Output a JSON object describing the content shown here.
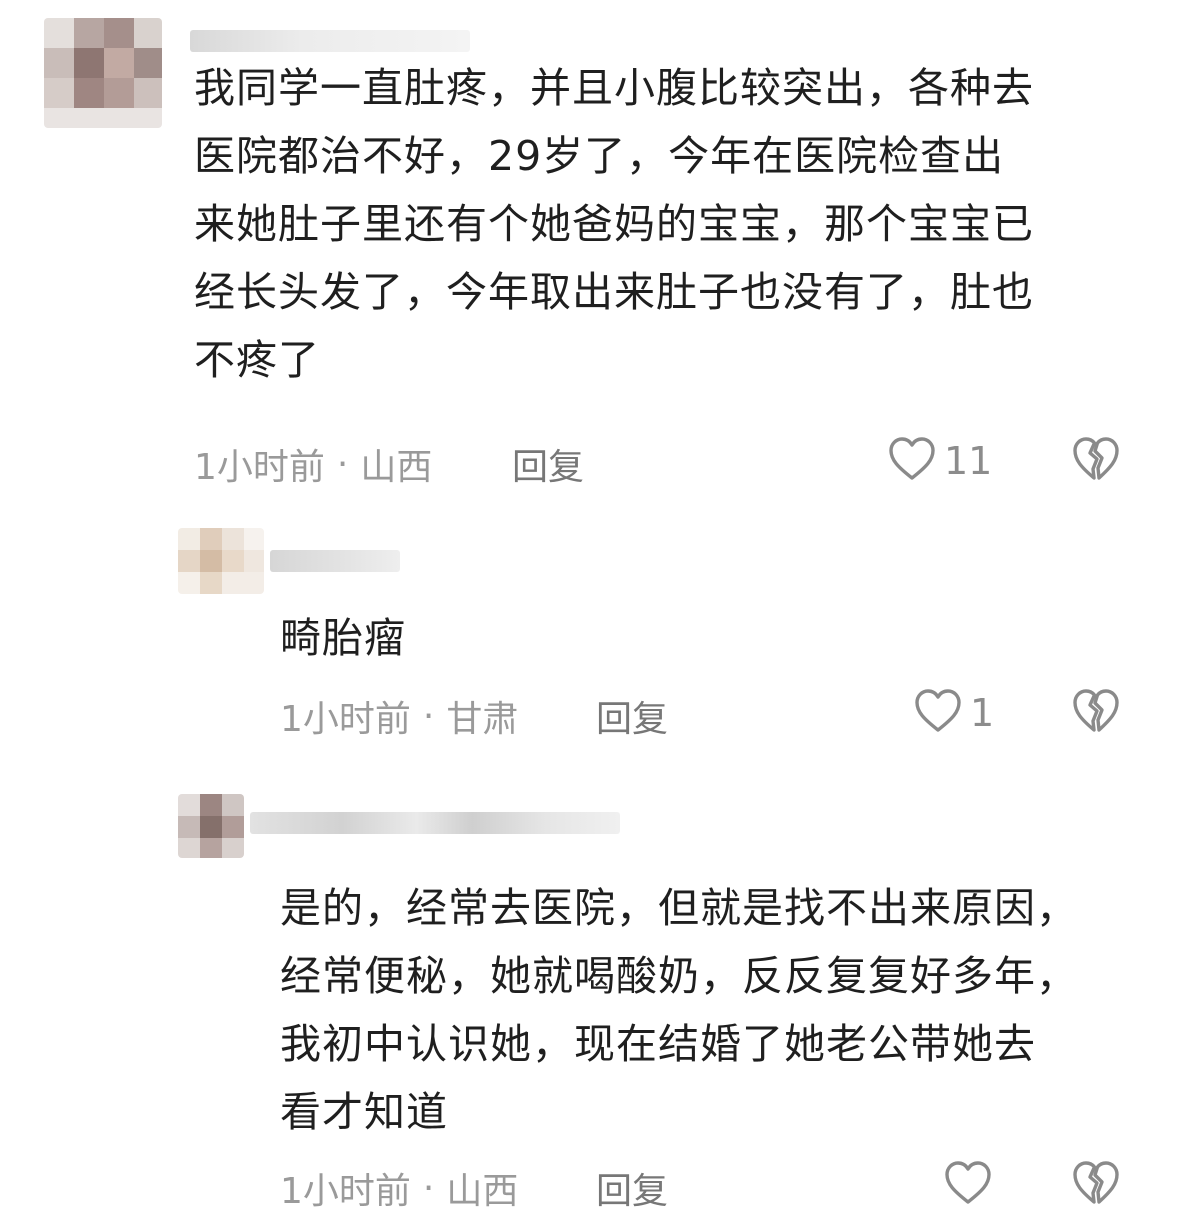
{
  "comments": [
    {
      "text": "我同学一直肚疼，并且小腹比较突出，各种去医院都治不好，29岁了，今年在医院检查出来她肚子里还有个她爸妈的宝宝，那个宝宝已经长头发了，今年取出来肚子也没有了，肚也不疼了",
      "lines": [
        "我同学一直肚疼，并且小腹比较突出，各种去",
        "医院都治不好，29岁了，今年在医院检查出",
        "来她肚子里还有个她爸妈的宝宝，那个宝宝已",
        "经长头发了，今年取出来肚子也没有了，肚也",
        "不疼了"
      ],
      "time": "1小时前",
      "location": "山西",
      "reply_label": "回复",
      "likes": "11"
    },
    {
      "lines": [
        "畸胎瘤"
      ],
      "time": "1小时前",
      "location": "甘肃",
      "reply_label": "回复",
      "likes": "1"
    },
    {
      "lines": [
        "是的，经常去医院，但就是找不出来原因，",
        "经常便秘，她就喝酸奶，反反复复好多年，",
        "我初中认识她，现在结婚了她老公带她去",
        "看才知道"
      ],
      "time": "1小时前",
      "location": "山西",
      "reply_label": "回复",
      "likes": ""
    }
  ],
  "meta_separator": "·",
  "icons": {
    "like": "heart-outline-icon",
    "dislike": "broken-heart-icon"
  },
  "colors": {
    "meta_text": "#9a9a9a",
    "body_text": "#1f1f1f",
    "icon_stroke": "#8a8a8a"
  }
}
